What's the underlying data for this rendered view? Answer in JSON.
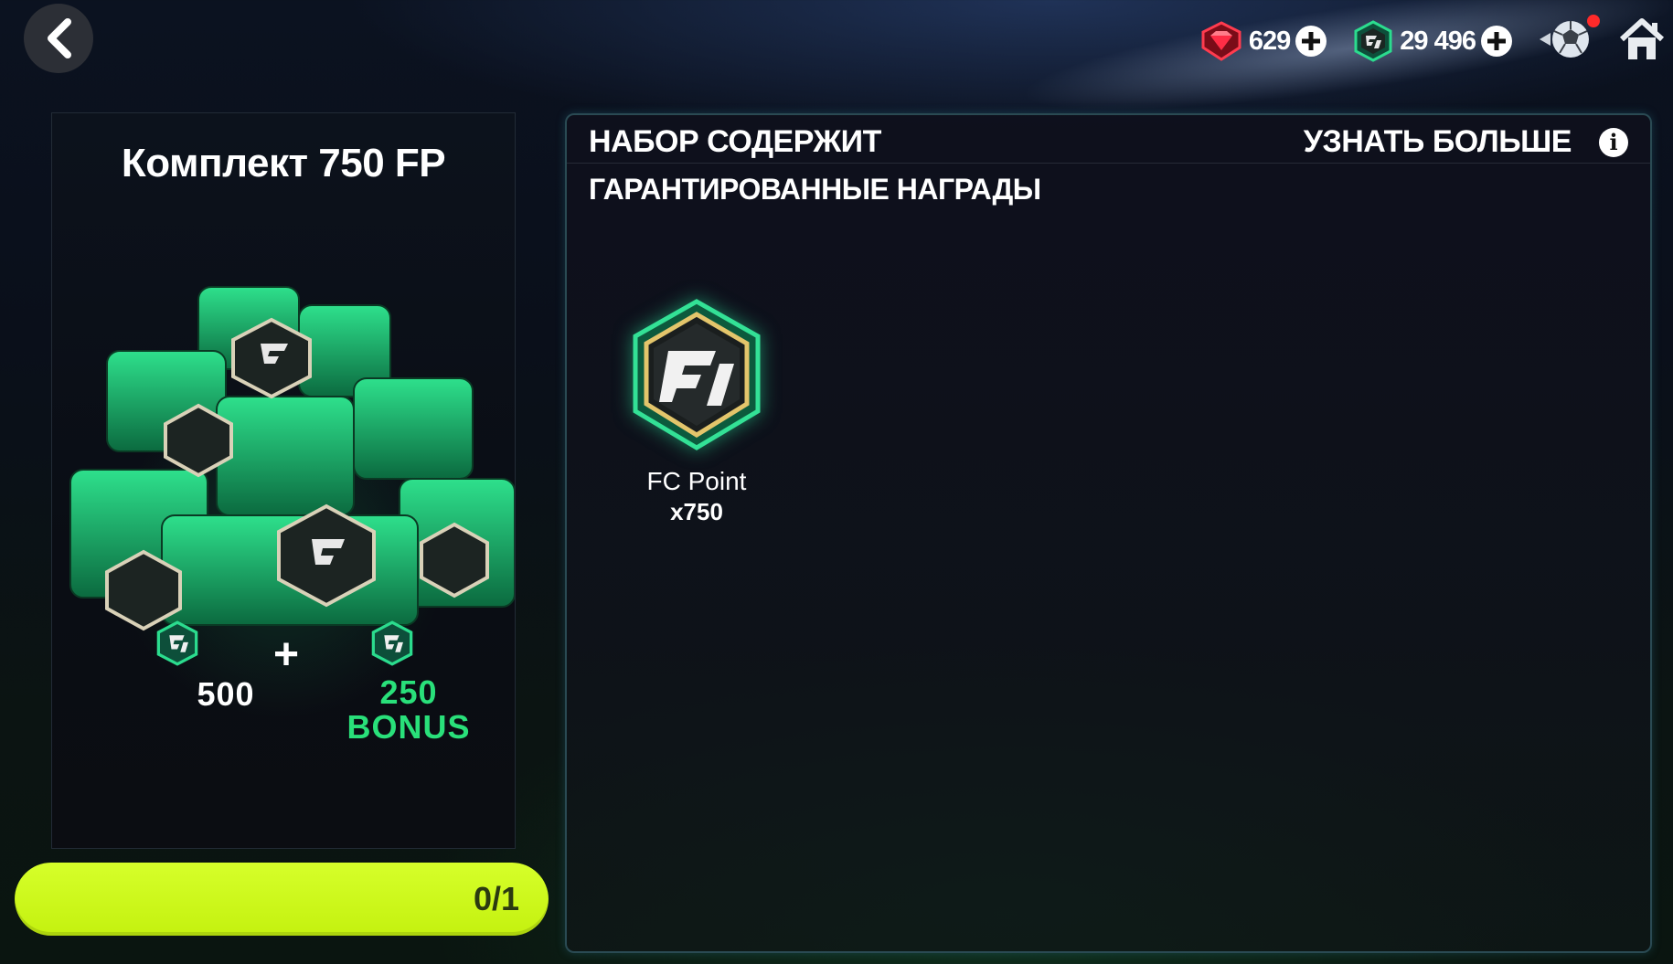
{
  "nav": {
    "back_icon": "chevron-left-icon"
  },
  "currencies": [
    {
      "name": "gems",
      "icon": "red-gem-icon",
      "value": "629"
    },
    {
      "name": "fc-points",
      "icon": "fc-point-icon",
      "value": "29 496"
    }
  ],
  "pack": {
    "title": "Комплект 750 FP",
    "base_amount": "500",
    "plus": "+",
    "bonus_amount": "250",
    "bonus_label": "BONUS"
  },
  "progress": {
    "label": "0/1",
    "value": 0,
    "max": 1
  },
  "contents": {
    "header": "НАБОР СОДЕРЖИТ",
    "learn_more": "УЗНАТЬ БОЛЬШЕ",
    "section_title": "ГАРАНТИРОВАННЫЕ НАГРАДЫ",
    "rewards": [
      {
        "icon": "fc-point-icon",
        "name": "FC Point",
        "quantity": "x750"
      }
    ]
  },
  "colors": {
    "accent_green": "#29e07a",
    "progress_fill": "#ccf518",
    "notification": "#ff2a2a",
    "gem_red": "#e0203a"
  }
}
